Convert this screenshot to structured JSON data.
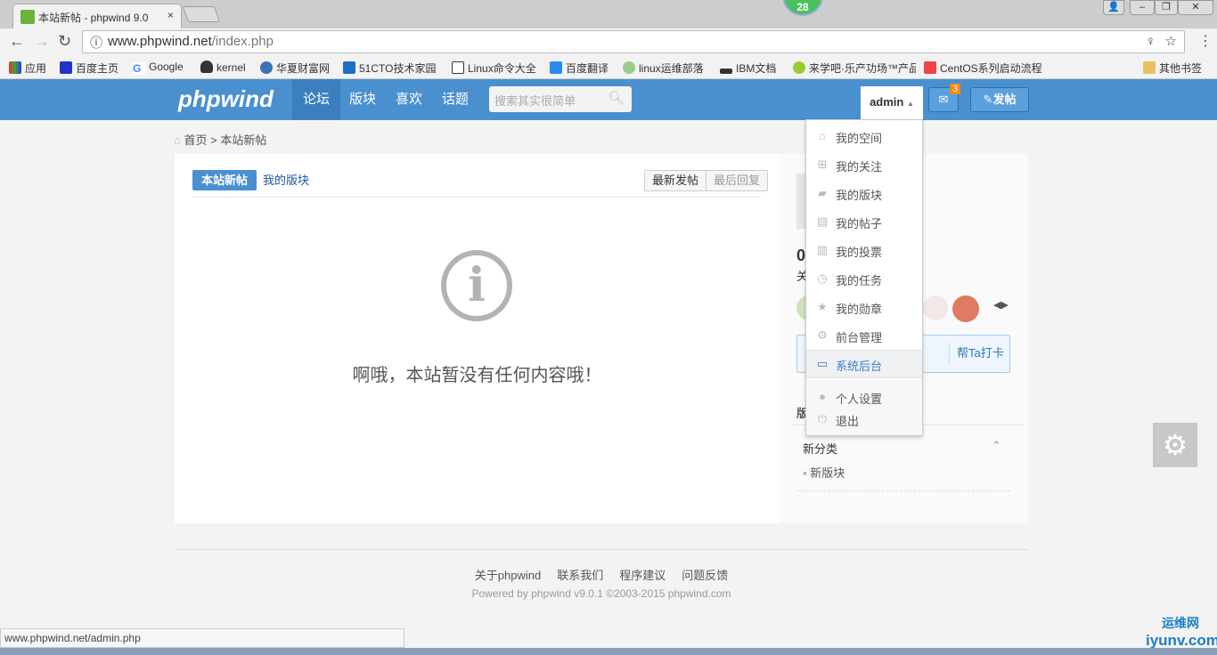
{
  "browser": {
    "tab_title": "本站新帖 - phpwind 9.0",
    "tab_close": "×",
    "counter_badge": "28",
    "url_host": "www.phpwind.net",
    "url_path": "/index.php",
    "bookmarks": [
      "应用",
      "百度主页",
      "Google",
      "kernel",
      "华夏财富网",
      "51CTO技术家园",
      "Linux命令大全",
      "百度翻译",
      "linux运维部落",
      "IBM文档",
      "来学吧·乐产功场™产品",
      "CentOS系列启动流程"
    ],
    "other_bookmarks": "其他书签"
  },
  "header": {
    "logo": "phpwind",
    "nav": [
      "论坛",
      "版块",
      "喜欢",
      "话题"
    ],
    "search_placeholder": "搜索其实很简单",
    "user": "admin",
    "mail_count": "3",
    "post_label": "发帖"
  },
  "breadcrumb": {
    "home": "首页",
    "sep": ">",
    "current": "本站新帖"
  },
  "main": {
    "tabs": [
      "本站新帖",
      "我的版块"
    ],
    "sort": [
      "最新发帖",
      "最后回复"
    ],
    "empty_message": "啊哦，本站暂没有任何内容哦！"
  },
  "user_menu": {
    "items": [
      {
        "label": "我的空间",
        "icon": "home-icon"
      },
      {
        "label": "我的关注",
        "icon": "follow-icon"
      },
      {
        "label": "我的版块",
        "icon": "chat-icon"
      },
      {
        "label": "我的帖子",
        "icon": "document-icon"
      },
      {
        "label": "我的投票",
        "icon": "bar-chart-icon"
      },
      {
        "label": "我的任务",
        "icon": "clock-icon"
      },
      {
        "label": "我的勋章",
        "icon": "medal-icon"
      },
      {
        "label": "前台管理",
        "icon": "gear-icon"
      },
      {
        "label": "系统后台",
        "icon": "monitor-icon"
      }
    ],
    "bottom": [
      {
        "label": "个人设置",
        "icon": "user-icon"
      },
      {
        "label": "退出",
        "icon": "power-icon"
      }
    ]
  },
  "sidebar": {
    "stat_num": "0",
    "stat_label": "关",
    "checkin": "帮Ta打卡",
    "section": "版",
    "category": "新分类",
    "forum": "新版块"
  },
  "footer": {
    "links": [
      "关于phpwind",
      "联系我们",
      "程序建议",
      "问题反馈"
    ],
    "powered": "Powered by phpwind v9.0.1 ©2003-2015 phpwind.com"
  },
  "status_url": "www.phpwind.net/admin.php",
  "watermark": [
    "运维网",
    "iyunv.com"
  ],
  "colors": {
    "brand": "#4a90cf",
    "accent": "#f80"
  }
}
